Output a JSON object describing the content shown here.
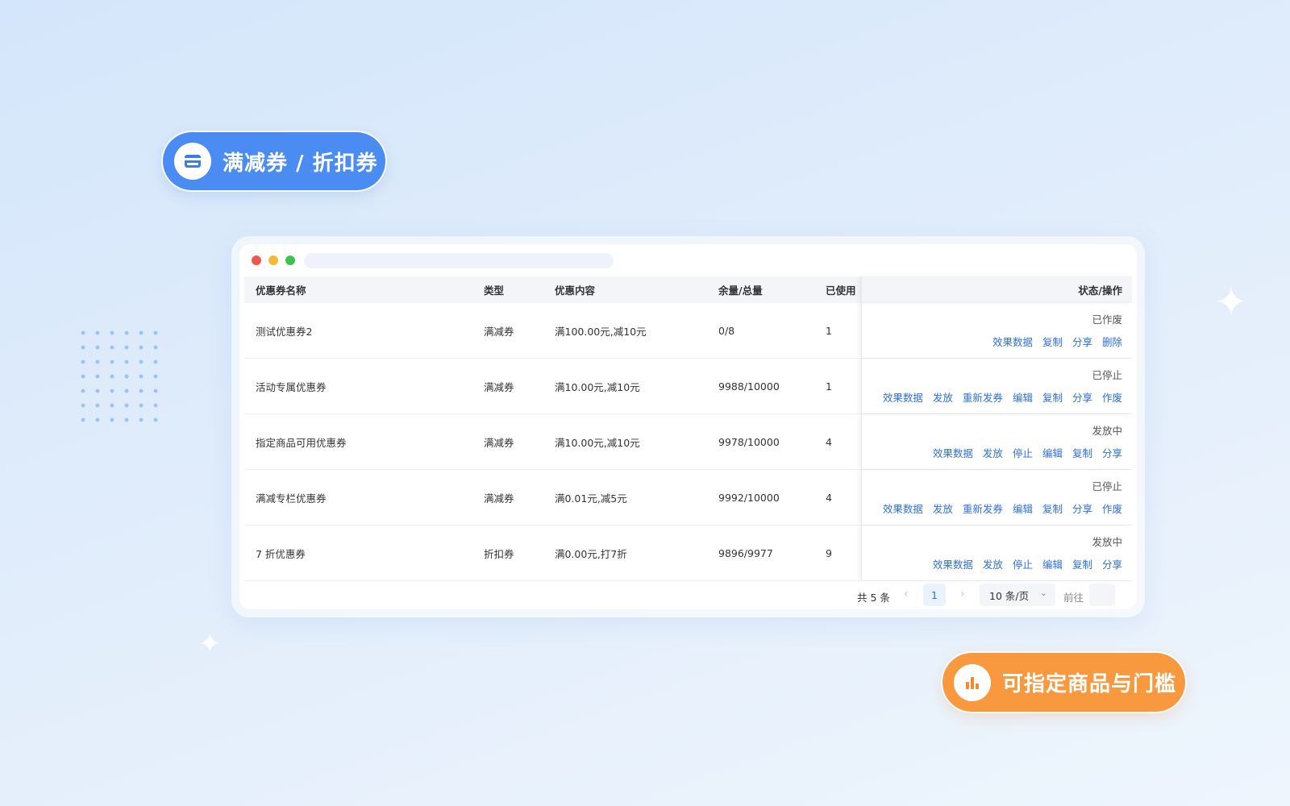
{
  "badges": {
    "top": {
      "label": "满减券 / 折扣券",
      "icon": "card-icon",
      "color": "#4b8cf3"
    },
    "bottom": {
      "label": "可指定商品与门槛",
      "icon": "bar-chart-icon",
      "color": "#f8993f"
    }
  },
  "table": {
    "headers": {
      "name": "优惠券名称",
      "type": "类型",
      "content": "优惠内容",
      "remain": "余量/总量",
      "used": "已使用",
      "status": "状态/操作"
    },
    "rows": [
      {
        "name": "测试优惠券2",
        "type": "满减券",
        "content": "满100.00元,减10元",
        "remain": "0/8",
        "used": "1",
        "status": "已作废",
        "actions": [
          "效果数据",
          "复制",
          "分享",
          "删除"
        ]
      },
      {
        "name": "活动专属优惠券",
        "type": "满减券",
        "content": "满10.00元,减10元",
        "remain": "9988/10000",
        "used": "1",
        "status": "已停止",
        "actions": [
          "效果数据",
          "发放",
          "重新发券",
          "编辑",
          "复制",
          "分享",
          "作废"
        ]
      },
      {
        "name": "指定商品可用优惠券",
        "type": "满减券",
        "content": "满10.00元,减10元",
        "remain": "9978/10000",
        "used": "4",
        "status": "发放中",
        "actions": [
          "效果数据",
          "发放",
          "停止",
          "编辑",
          "复制",
          "分享"
        ]
      },
      {
        "name": "满减专栏优惠券",
        "type": "满减券",
        "content": "满0.01元,减5元",
        "remain": "9992/10000",
        "used": "4",
        "status": "已停止",
        "actions": [
          "效果数据",
          "发放",
          "重新发券",
          "编辑",
          "复制",
          "分享",
          "作废"
        ]
      },
      {
        "name": "7 折优惠券",
        "type": "折扣券",
        "content": "满0.00元,打7折",
        "remain": "9896/9977",
        "used": "9",
        "status": "发放中",
        "actions": [
          "效果数据",
          "发放",
          "停止",
          "编辑",
          "复制",
          "分享"
        ]
      }
    ]
  },
  "pagination": {
    "total": "共 5 条",
    "current_page": "1",
    "page_size": "10 条/页",
    "goto_label": "前往"
  },
  "colors": {
    "link": "#2f6fd8",
    "header_bg": "#f3f5f8"
  }
}
